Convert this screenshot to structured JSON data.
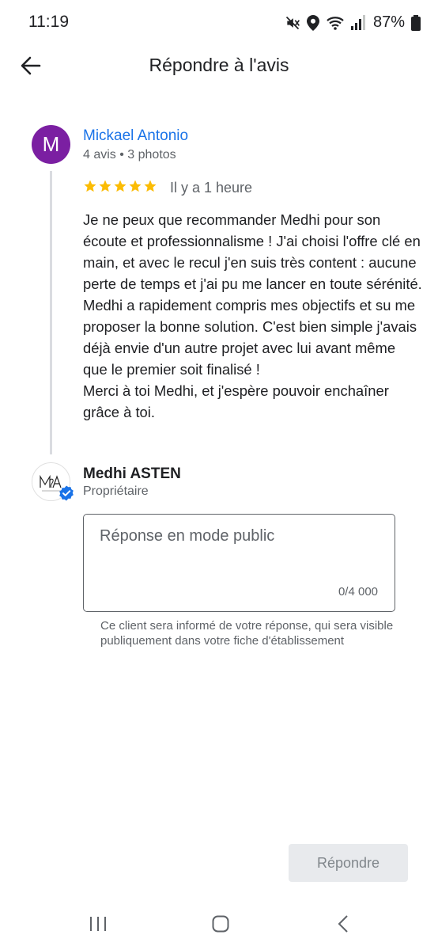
{
  "status_bar": {
    "time": "11:19",
    "battery": "87%",
    "icons": [
      "mute-icon",
      "location-icon",
      "wifi-icon",
      "signal-icon",
      "battery-icon"
    ]
  },
  "header": {
    "title": "Répondre à l'avis",
    "back_icon": "arrow-left-icon"
  },
  "review": {
    "avatar_letter": "M",
    "avatar_color": "#7b1fa2",
    "reviewer_name": "Mickael Antonio",
    "reviewer_meta": "4 avis • 3 photos",
    "rating": 5,
    "time": "Il y a 1 heure",
    "text": "Je ne peux que recommander Medhi pour son écoute et professionnalisme ! J'ai choisi l'offre clé en main, et avec le recul j'en suis très content : aucune perte de temps et j'ai pu me lancer en toute sérénité. Medhi a rapidement compris mes objectifs et su me proposer la bonne solution. C'est bien simple j'avais déjà envie d'un autre projet avec lui avant même que le premier soit finalisé !\nMerci à toi Medhi, et j'espère pouvoir enchaîner grâce à toi."
  },
  "owner": {
    "logo_text": "M&A",
    "name": "Medhi ASTEN",
    "role": "Propriétaire"
  },
  "reply": {
    "placeholder": "Réponse en mode public",
    "value": "",
    "counter": "0/4 000",
    "helper": "Ce client sera informé de votre réponse, qui sera visible publiquement dans votre fiche d'établissement"
  },
  "actions": {
    "submit_label": "Répondre"
  },
  "colors": {
    "accent_blue": "#1a73e8",
    "star": "#fbbc04",
    "verified": "#1a73e8"
  }
}
